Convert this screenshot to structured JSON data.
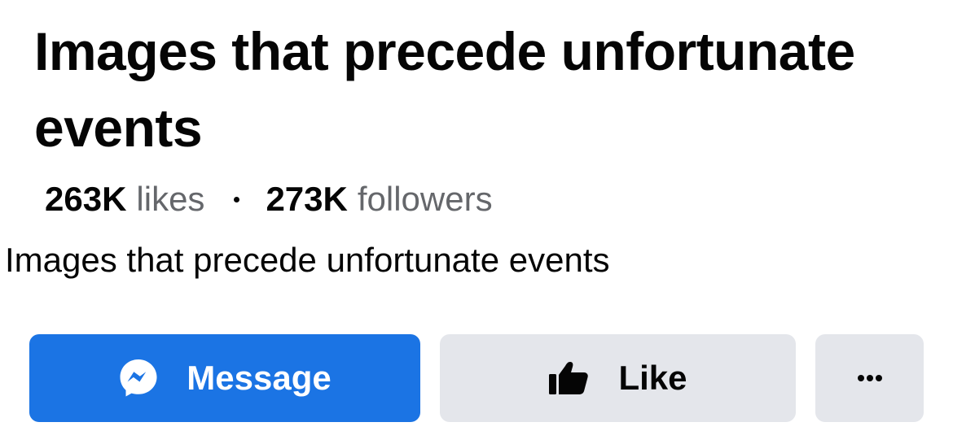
{
  "page": {
    "title": "Images that precede unfortunate events",
    "stats": {
      "likes_count": "263K",
      "likes_label": "likes",
      "followers_count": "273K",
      "followers_label": "followers"
    },
    "description": "Images that precede unfortunate events"
  },
  "actions": {
    "message": {
      "label": "Message",
      "icon": "messenger-icon",
      "color": "#1b74e4"
    },
    "like": {
      "label": "Like",
      "icon": "thumbs-up-icon",
      "color": "#e4e6eb"
    },
    "more": {
      "icon": "more-options-icon",
      "color": "#e4e6eb"
    }
  }
}
